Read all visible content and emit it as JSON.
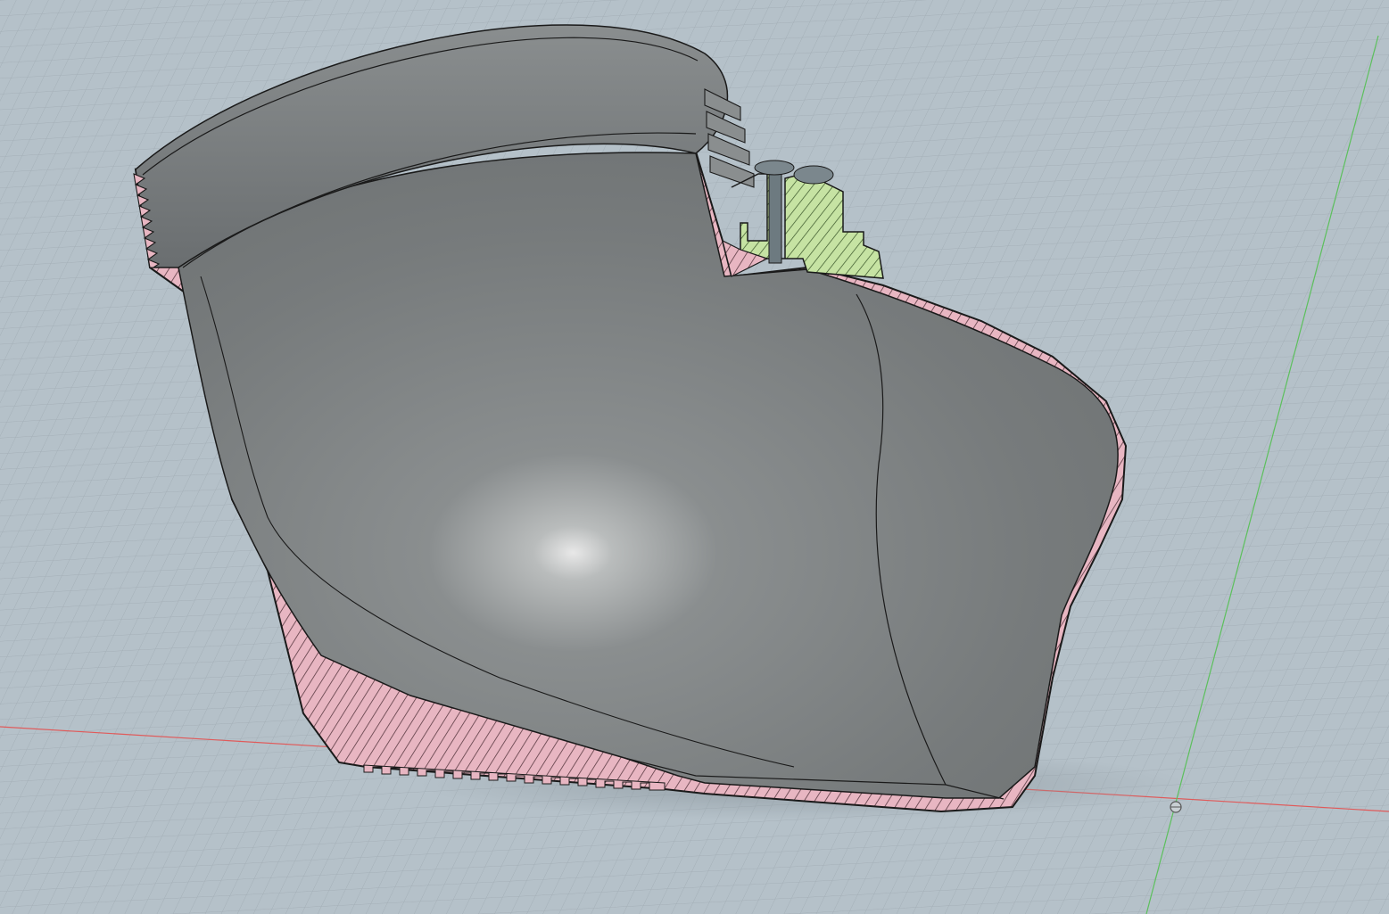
{
  "viewport": {
    "view_type": "3d-model-section-view",
    "background_color": "#b5c1c9",
    "grid_color": "#9aa6ae",
    "grid_major_color": "#8d99a1",
    "x_axis_color": "#e05a5a",
    "y_axis_color": "#5cc05c",
    "model_surface_color": "#7d8183",
    "section_hatch_color": "#e8b6c2",
    "section_insert_color": "#c6e3a3",
    "outline_color": "#1a1a1a"
  },
  "model": {
    "description_icon": "section-cut-body-icon",
    "insert_icon": "threaded-insert-icon",
    "origin_icon": "origin-point-icon"
  }
}
